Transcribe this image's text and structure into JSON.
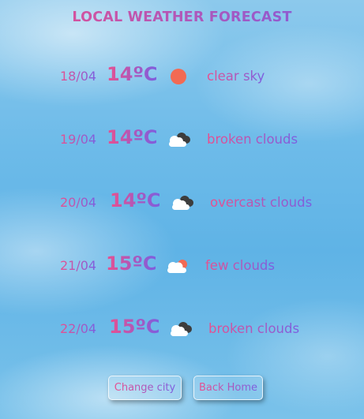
{
  "page": {
    "title": "LOCAL WEATHER FORECAST"
  },
  "forecast": [
    {
      "date": "18/04",
      "temp": "14ºC",
      "icon": "sun-icon",
      "description": "clear sky"
    },
    {
      "date": "19/04",
      "temp": "14ºC",
      "icon": "broken-clouds-icon",
      "description": "broken clouds"
    },
    {
      "date": "20/04",
      "temp": "14ºC",
      "icon": "overcast-clouds-icon",
      "description": "overcast clouds"
    },
    {
      "date": "21/04",
      "temp": "15ºC",
      "icon": "few-clouds-icon",
      "description": "few clouds"
    },
    {
      "date": "22/04",
      "temp": "15ºC",
      "icon": "broken-clouds-icon",
      "description": "broken clouds"
    }
  ],
  "buttons": {
    "change_city": "Change city",
    "back_home": "Back Home"
  },
  "colors": {
    "accent_pink": "#e8508f",
    "accent_purple": "#7b5ee0",
    "sun": "#f26a54"
  }
}
